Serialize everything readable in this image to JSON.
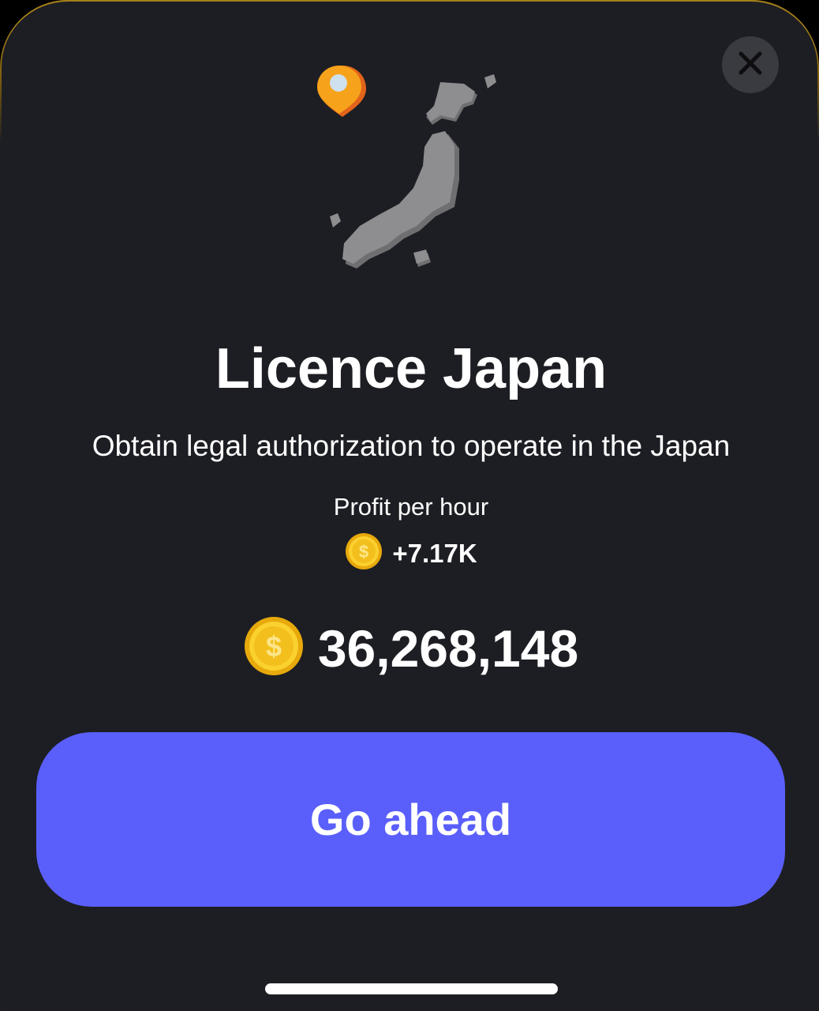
{
  "modal": {
    "title": "Licence Japan",
    "description": "Obtain legal authorization to operate in the Japan",
    "profit_label": "Profit per hour",
    "profit_value": "+7.17K",
    "cost": "36,268,148",
    "action_label": "Go ahead",
    "close_icon": "close-icon"
  },
  "icons": {
    "illustration": "japan-map-icon",
    "location_pin": "location-pin-icon",
    "coin": "coin-icon"
  },
  "colors": {
    "background": "#1d1e23",
    "button": "#5a5ffb",
    "coin": "#f5c518",
    "pin": "#f08a1c",
    "map": "#8d8d8f"
  }
}
